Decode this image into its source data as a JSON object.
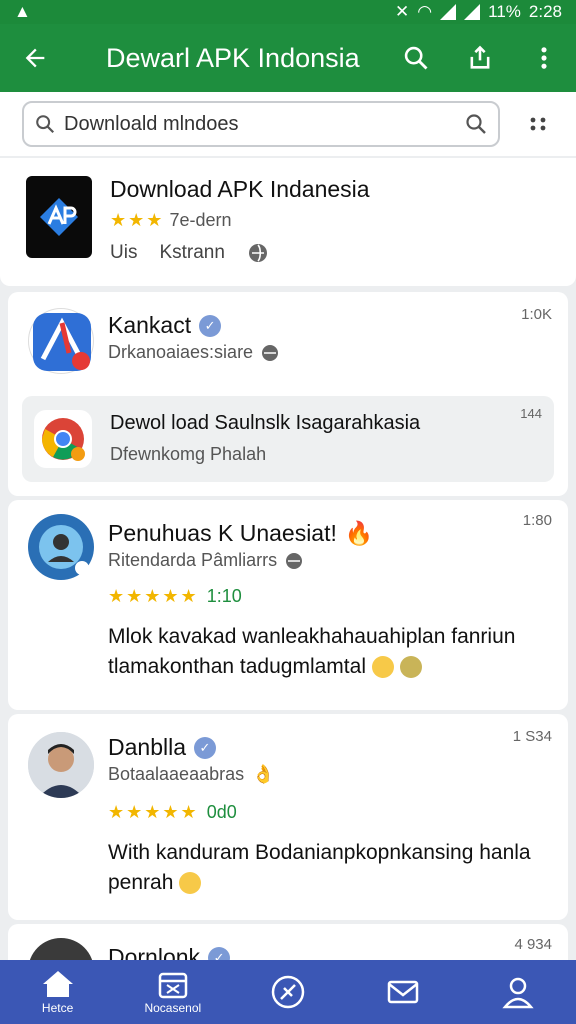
{
  "status": {
    "battery": "11%",
    "time": "2:28"
  },
  "appbar": {
    "title": "Dewarl APK Indonsia"
  },
  "search": {
    "value": "Downloald mlndoes"
  },
  "app": {
    "name": "Download APK Indanesia",
    "rating_label": "7e-dern",
    "meta_left": "Uis",
    "meta_mid": "Kstrann"
  },
  "posts": [
    {
      "name": "Kankact",
      "sub": "Drkanoaiaes:siare",
      "time": "1:0K",
      "link": {
        "title": "Dewol load Saulnslk Isagarahkasia",
        "sub": "Dfewnkomg Phalah",
        "time": "144"
      }
    },
    {
      "name": "Penuhuas K Unaesiat!",
      "sub": "Ritendarda Pâmliarrs",
      "time": "1:80",
      "rating": "1:10",
      "body": "Mlok kavakad wanleakhahauahiplan fanriun tlamakonthan tadugmlamtal"
    },
    {
      "name": "Danblla",
      "sub": "Botaalaaeaabras",
      "time": "1 S34",
      "rating": "0d0",
      "body": "With kanduram Bodanianpkopnkansing hanla penrah"
    },
    {
      "name": "Dornlonk",
      "time": "4 934"
    }
  ],
  "nav": [
    {
      "label": "Hetce",
      "icon": "home-icon"
    },
    {
      "label": "Nocasenol",
      "icon": "calendar-icon"
    },
    {
      "label": "",
      "icon": "compass-icon"
    },
    {
      "label": "",
      "icon": "mail-icon"
    },
    {
      "label": "",
      "icon": "profile-icon"
    }
  ]
}
